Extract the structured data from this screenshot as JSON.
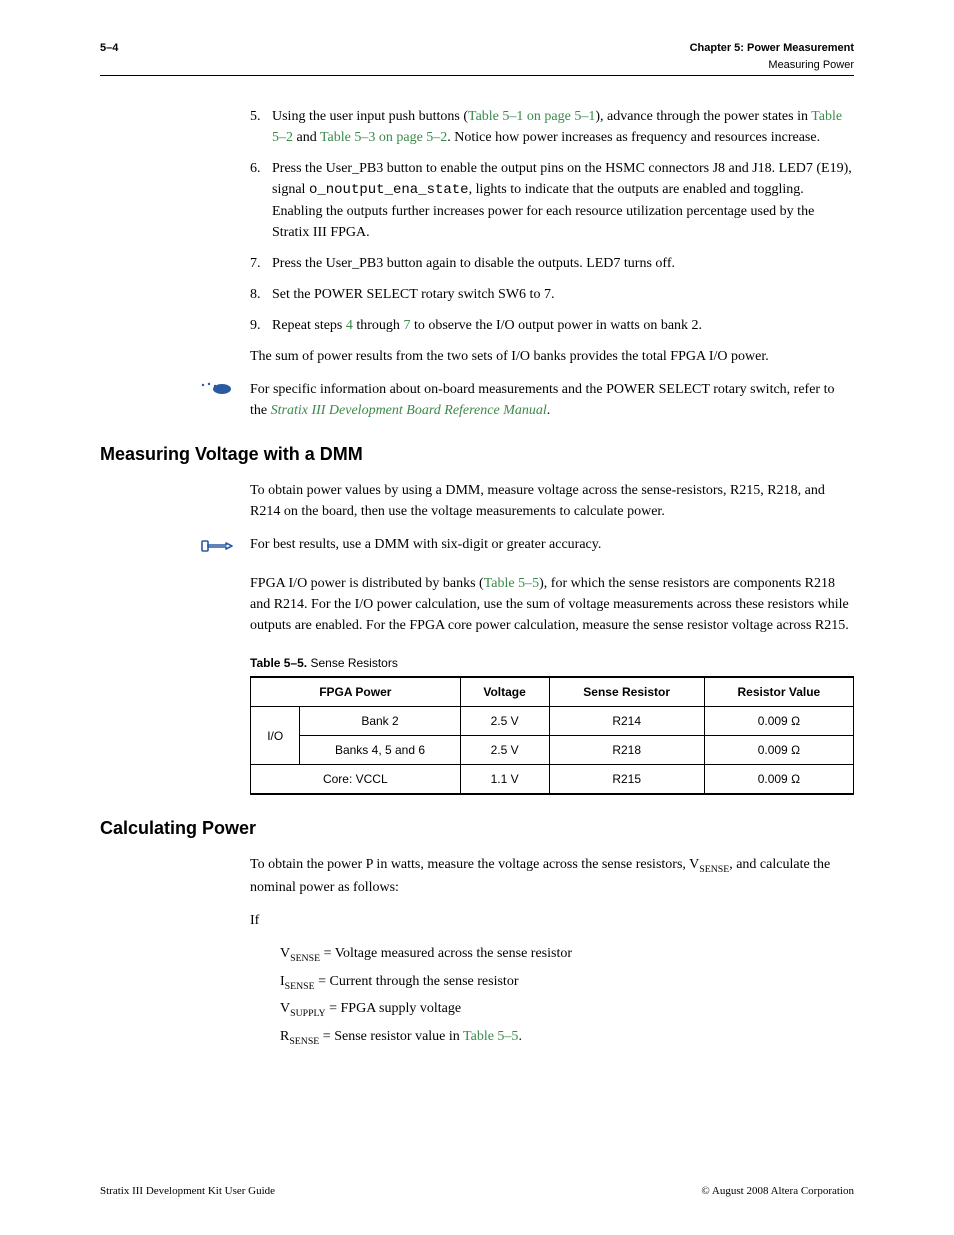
{
  "header": {
    "page_num": "5–4",
    "chapter_label": "Chapter 5:  Power Measurement",
    "section_label": "Measuring Power"
  },
  "step5": {
    "num": "5.",
    "t1": "Using the user input push buttons (",
    "link1": "Table 5–1 on page 5–1",
    "t2": "), advance through the power states in ",
    "link2": "Table 5–2",
    "t3": " and ",
    "link3": "Table 5–3 on page 5–2",
    "t4": ". Notice how power increases as frequency and resources increase."
  },
  "step6": {
    "num": "6.",
    "t1": "Press the User_PB3 button to enable the output pins on the HSMC connectors J8 and J18. LED7 (E19), signal ",
    "code": "o_noutput_ena_state",
    "t2": ", lights to indicate that the outputs are enabled and toggling. Enabling the outputs further increases power for each resource utilization percentage used by the Stratix III FPGA."
  },
  "step7": {
    "num": "7.",
    "t": "Press the User_PB3 button again to disable the outputs. LED7 turns off."
  },
  "step8": {
    "num": "8.",
    "t": "Set the POWER SELECT rotary switch SW6 to 7."
  },
  "step9": {
    "num": "9.",
    "t1": "Repeat steps ",
    "l1": "4",
    "t2": " through ",
    "l2": "7",
    "t3": " to observe the I/O output power in watts on bank 2."
  },
  "sum_para": "The sum of power results from the two sets of I/O banks provides the total FPGA I/O power.",
  "note1": {
    "t1": "For specific information about on-board measurements and the POWER SELECT rotary switch, refer to the ",
    "link": "Stratix III Development Board Reference Manual",
    "t2": "."
  },
  "h_dmm": "Measuring Voltage with a DMM",
  "dmm_p1": "To obtain power values by using a DMM, measure voltage across the sense-resistors, R215, R218, and R214 on the board, then use the voltage measurements to calculate power.",
  "note2": "For best results, use a DMM with six-digit or greater accuracy.",
  "dmm_p2": {
    "t1": "FPGA I/O power is distributed by banks (",
    "link": "Table 5–5",
    "t2": "), for which the sense resistors are components R218 and R214. For the I/O power calculation, use the sum of voltage measurements across these resistors while outputs are enabled. For the FPGA core power calculation, measure the sense resistor voltage across R215."
  },
  "table": {
    "caption_bold": "Table 5–5.",
    "caption_rest": "  Sense Resistors",
    "h1": "FPGA Power",
    "h2": "Voltage",
    "h3": "Sense Resistor",
    "h4": "Resistor Value",
    "r1c1": "I/O",
    "r1c2": "Bank 2",
    "r1c3": "2.5 V",
    "r1c4": "R214",
    "r1c5": "0.009 Ω",
    "r2c2": "Banks 4, 5 and 6",
    "r2c3": "2.5 V",
    "r2c4": "R218",
    "r2c5": "0.009 Ω",
    "r3c1": "Core: VCCL",
    "r3c3": "1.1 V",
    "r3c4": "R215",
    "r3c5": "0.009 Ω"
  },
  "h_calc": "Calculating Power",
  "calc_p1": {
    "t1": "To obtain the power P in watts, measure the voltage across the sense resistors, V",
    "sub": "SENSE",
    "t2": ", and calculate the nominal power as follows:"
  },
  "if_label": "If",
  "def1": {
    "v": "V",
    "s": "SENSE",
    "t": " = Voltage measured across the sense resistor"
  },
  "def2": {
    "v": "I",
    "s": "SENSE",
    "t": " = Current through the sense resistor"
  },
  "def3": {
    "v": "V",
    "s": "SUPPLY",
    "t": " = FPGA supply voltage"
  },
  "def4": {
    "v": "R",
    "s": "SENSE",
    "t1": " = Sense resistor value in ",
    "link": "Table 5–5",
    "t2": "."
  },
  "footer": {
    "left": "Stratix III Development Kit User Guide",
    "right": "© August 2008   Altera Corporation"
  }
}
